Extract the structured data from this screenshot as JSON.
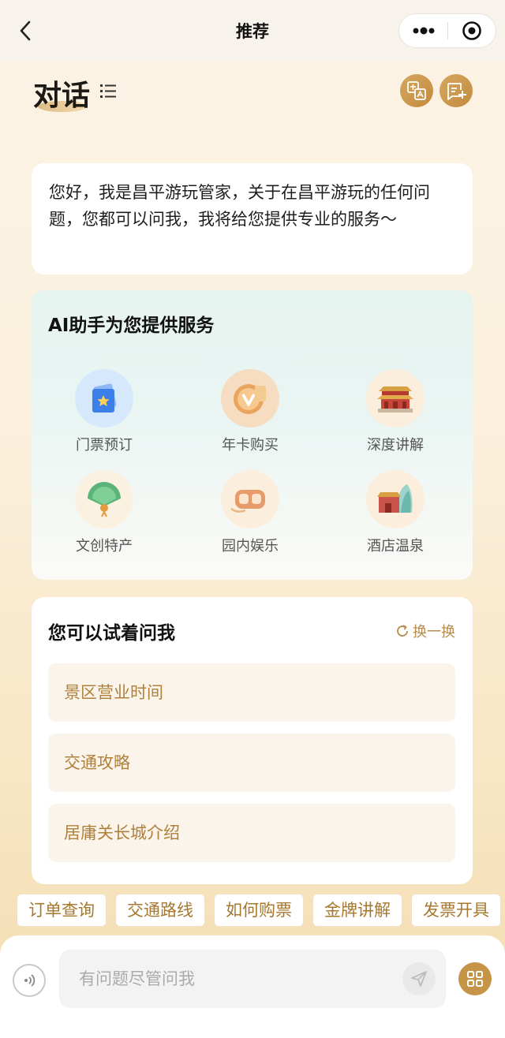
{
  "nav": {
    "title": "推荐"
  },
  "header": {
    "title": "对话"
  },
  "greeting": {
    "text": "您好，我是昌平游玩管家，关于在昌平游玩的任何问题，您都可以问我，我将给您提供专业的服务～"
  },
  "services": {
    "title": "AI助手为您提供服务",
    "items": [
      {
        "label": "门票预订",
        "icon": "ticket-icon"
      },
      {
        "label": "年卡购买",
        "icon": "annual-card-icon"
      },
      {
        "label": "深度讲解",
        "icon": "palace-icon"
      },
      {
        "label": "文创特产",
        "icon": "fan-icon"
      },
      {
        "label": "园内娱乐",
        "icon": "vr-goggles-icon"
      },
      {
        "label": "酒店温泉",
        "icon": "hotel-icon"
      }
    ]
  },
  "suggest": {
    "title": "您可以试着问我",
    "refresh": "换一换",
    "questions": [
      "景区营业时间",
      "交通攻略",
      "居庸关长城介绍"
    ]
  },
  "chips": [
    "订单查询",
    "交通路线",
    "如何购票",
    "金牌讲解",
    "发票开具"
  ],
  "input": {
    "placeholder": "有问题尽管问我"
  },
  "colors": {
    "accent": "#c59446",
    "suggest_text": "#b0803b"
  }
}
